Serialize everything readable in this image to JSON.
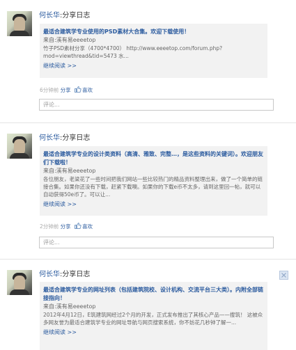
{
  "posts": [
    {
      "author": "何长华",
      "separator": ":",
      "share_type": "分享日志",
      "title": "最适合建筑学专业使用的PSD素材大合集。欢迎下载使用！",
      "from_label": "来自:",
      "from_source": "溪有易eeeetop",
      "excerpt": "竹子PSD素材分享（4700*4700） http://www.eeeetop.com/forum.php?mod=viewthread&tid=5473 水...",
      "read_more": "继续阅读 >>",
      "time": "6分钟前",
      "share_label": "分享",
      "like_label": "喜欢",
      "comment_placeholder": "评论..."
    },
    {
      "author": "何长华",
      "separator": ":",
      "share_type": "分享日志",
      "title": "最适合建筑学专业的设计类资料（高清、雅致、完整…，是这些资料的关键词）。欢迎朋友们下载啦！",
      "from_label": "来自:",
      "from_source": "溪有易eeeetop",
      "excerpt": "各位朋友，老梁花了一些时间把我们网站一些比较热门的精品资料整理出来，做了一个简单的链接合集。如果你还没有下载，赶紧下载噢。如果你的下载e币不太多，请到这里回一帖，就可以自动获得50e币了。可以让...",
      "read_more": "继续阅读 >>",
      "time": "2分钟前",
      "share_label": "分享",
      "like_label": "喜欢",
      "comment_placeholder": "评论..."
    },
    {
      "author": "何长华",
      "separator": ":",
      "share_type": "分享日志",
      "title": "最适合建筑学专业的网址列表（包括建筑院校、设计机构、交流平台三大类）。内附全部链接指向！",
      "from_label": "来自:",
      "from_source": "溪有易eeeetop",
      "excerpt": "2012年4月12日，E筑建筑网经过2个月的开发，正式发布推出了其核心产品——搜筑！ 这被众多网友誉为最适合建筑学专业的网址导航与网页搜索系统，你不妨花几秒钟了解一...",
      "read_more": "继续阅读 >>"
    }
  ]
}
